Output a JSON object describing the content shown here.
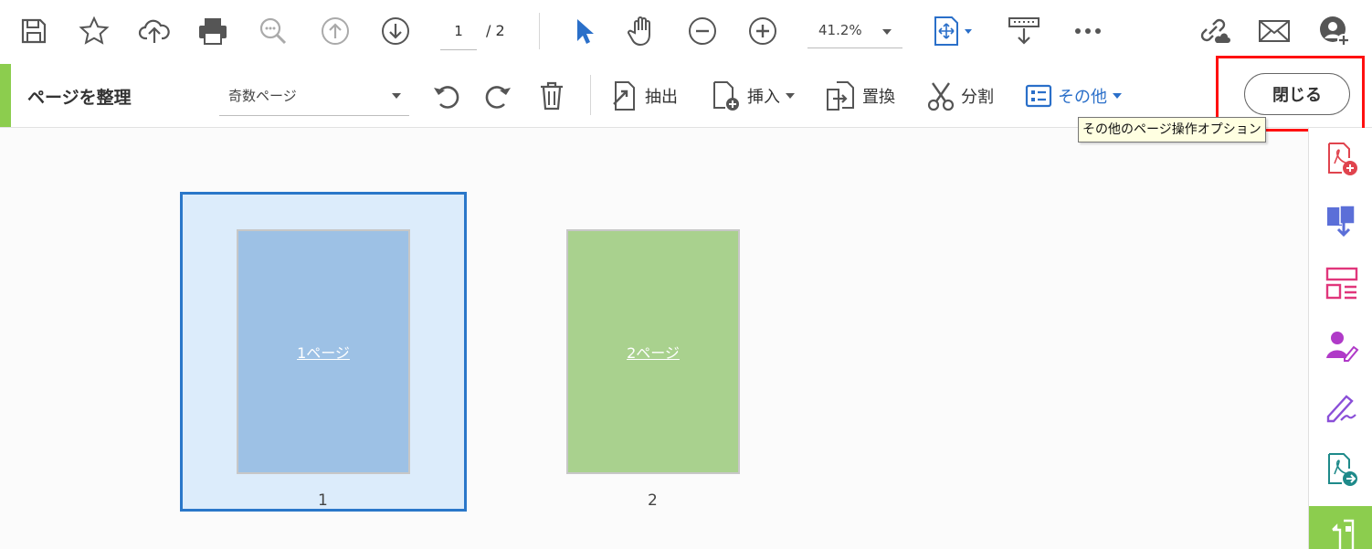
{
  "toolbar": {
    "current_page": "1",
    "total_pages": "/ 2",
    "zoom": "41.2%",
    "icons": [
      "save-icon",
      "star-icon",
      "cloud-upload-icon",
      "print-icon",
      "zoom-search-icon",
      "page-up-icon",
      "page-down-icon",
      "select-arrow-icon",
      "hand-icon",
      "zoom-out-icon",
      "zoom-in-icon",
      "fit-page-icon",
      "scroll-mode-icon",
      "more-icon",
      "link-cloud-icon",
      "mail-icon",
      "add-user-icon"
    ]
  },
  "organize": {
    "title": "ページを整理",
    "filter_value": "奇数ページ",
    "extract_label": "抽出",
    "insert_label": "挿入",
    "replace_label": "置換",
    "split_label": "分割",
    "more_label": "その他",
    "close_label": "閉じる",
    "tooltip": "その他のページ操作オプション"
  },
  "pages": [
    {
      "label": "1ページ",
      "number": "1",
      "color": "#9dc1e5"
    },
    {
      "label": "2ページ",
      "number": "2",
      "color": "#a9d18e"
    }
  ],
  "colors": {
    "accent_blue": "#2a77c9",
    "green": "#8ccd4e",
    "highlight_red": "#ff1010"
  },
  "rail": {
    "icons": [
      "create-pdf-icon",
      "combine-files-icon",
      "organize-icon",
      "request-signature-icon",
      "fill-sign-icon",
      "export-pdf-icon",
      "organize-pages-active-icon"
    ]
  }
}
